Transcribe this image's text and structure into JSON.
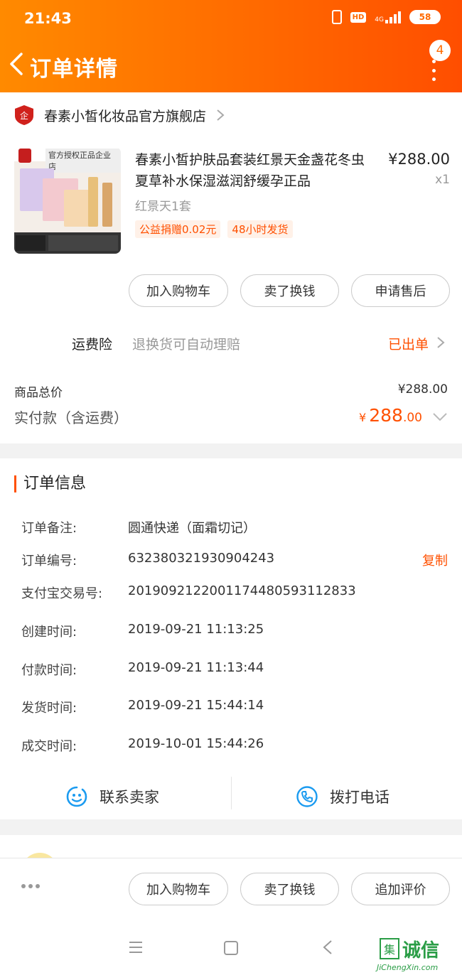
{
  "status_bar": {
    "time": "21:43",
    "hd": "HD",
    "network": "4G",
    "battery": "58"
  },
  "nav": {
    "title": "订单详情",
    "badge_count": "4"
  },
  "shop": {
    "name": "春素小皙化妆品官方旗舰店"
  },
  "product": {
    "thumb_tag": "官方授权正品企业店",
    "name": "春素小皙护肤品套装红景天金盏花冬虫夏草补水保湿滋润舒缓孕正品",
    "price": "¥288.00",
    "qty": "x1",
    "sku": "红景天1套",
    "tags": [
      "公益捐赠0.02元",
      "48小时发货"
    ]
  },
  "item_actions": [
    "加入购物车",
    "卖了换钱",
    "申请售后"
  ],
  "insurance": {
    "label": "运费险",
    "desc": "退换货可自动理赔",
    "status": "已出单"
  },
  "summary": {
    "goods_total_label": "商品总价",
    "goods_total": "¥288.00",
    "paid_label": "实付款（含运费）",
    "paid_currency": "¥",
    "paid_int": "288",
    "paid_dec": ".00"
  },
  "order_info": {
    "title": "订单信息",
    "rows": [
      {
        "k": "订单备注:",
        "v": "圆通快递（面霜切记）"
      },
      {
        "k": "订单编号:",
        "v": "632380321930904243"
      },
      {
        "k": "支付宝交易号:",
        "v": "2019092122001174480593112833"
      },
      {
        "k": "创建时间:",
        "v": "2019-09-21 11:13:25"
      },
      {
        "k": "付款时间:",
        "v": "2019-09-21 11:13:44"
      },
      {
        "k": "发货时间:",
        "v": "2019-09-21 15:44:14"
      },
      {
        "k": "成交时间:",
        "v": "2019-10-01 15:44:26"
      }
    ],
    "copy": "复制"
  },
  "contact": {
    "seller": "联系卖家",
    "call": "拨打电话"
  },
  "bottom_actions": [
    "加入购物车",
    "卖了换钱",
    "追加评价"
  ],
  "watermark": {
    "mark": "集",
    "text": "诚信",
    "url": "JiChengXin.com"
  },
  "colors": {
    "accent": "#ff5000",
    "header_start": "#ff8a00",
    "header_end": "#ff4e00"
  }
}
